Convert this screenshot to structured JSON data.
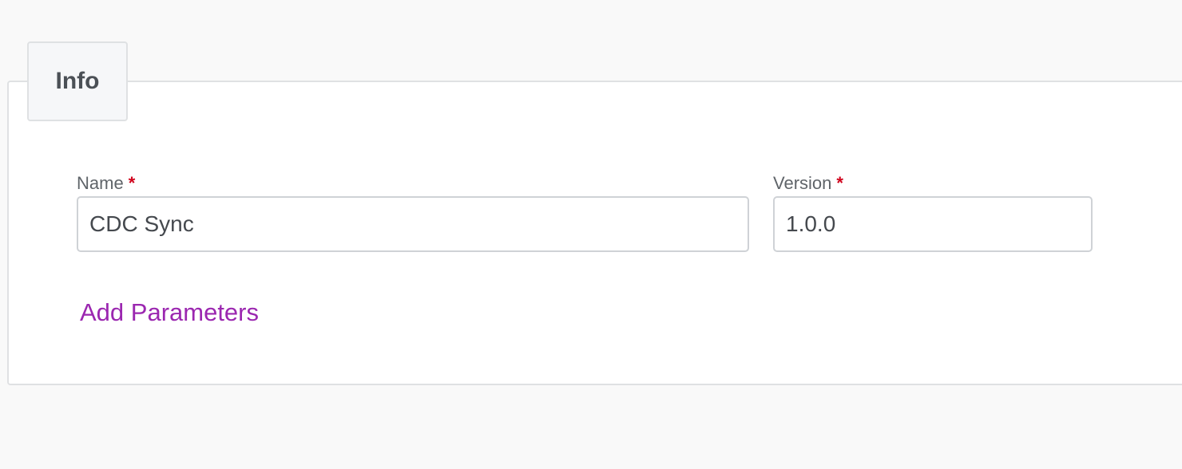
{
  "tab": {
    "label": "Info"
  },
  "form": {
    "name": {
      "label": "Name",
      "required_mark": "*",
      "value": "CDC Sync"
    },
    "version": {
      "label": "Version",
      "required_mark": "*",
      "value": "1.0.0"
    }
  },
  "actions": {
    "add_parameters_label": "Add Parameters"
  },
  "colors": {
    "accent_link": "#9b27b0",
    "required_mark": "#d0021b",
    "background": "#f9f9f9",
    "panel": "#ffffff"
  }
}
